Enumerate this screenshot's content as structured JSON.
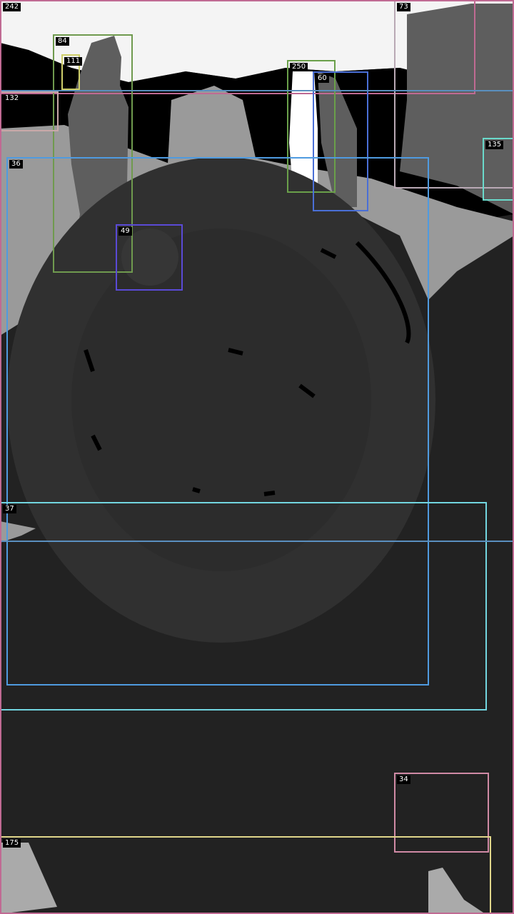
{
  "scene": {
    "description_free": true,
    "colors": {
      "background": "#222222",
      "sky": "#f4f4f4",
      "black": "#000000",
      "light_gray": "#9a9a9a",
      "mid_gray": "#5e5e5e",
      "dark_gray": "#2e2e2e",
      "wheel_gray": "#303030",
      "white": "#ffffff"
    }
  },
  "labels": [
    {
      "text": "242",
      "color": "#c06a93"
    },
    {
      "text": "73",
      "color": "#b9a9b5"
    },
    {
      "text": "84",
      "color": "#6f9a4e"
    },
    {
      "text": "111",
      "color": "#cfcf6a"
    },
    {
      "text": "132",
      "color": "#c9a9a9"
    },
    {
      "text": "250",
      "color": "#6aa04a"
    },
    {
      "text": "60",
      "color": "#4a6fd6"
    },
    {
      "text": "135",
      "color": "#6adacb"
    },
    {
      "text": "36",
      "color": "#4f9be0"
    },
    {
      "text": "49",
      "color": "#5a4ad6"
    },
    {
      "text": "37",
      "color": "#72d6e0"
    },
    {
      "text": "34",
      "color": "#d08aa5"
    },
    {
      "text": "175",
      "color": "#e0d68a"
    },
    {
      "text": "",
      "color": "#5a8fbf"
    }
  ]
}
